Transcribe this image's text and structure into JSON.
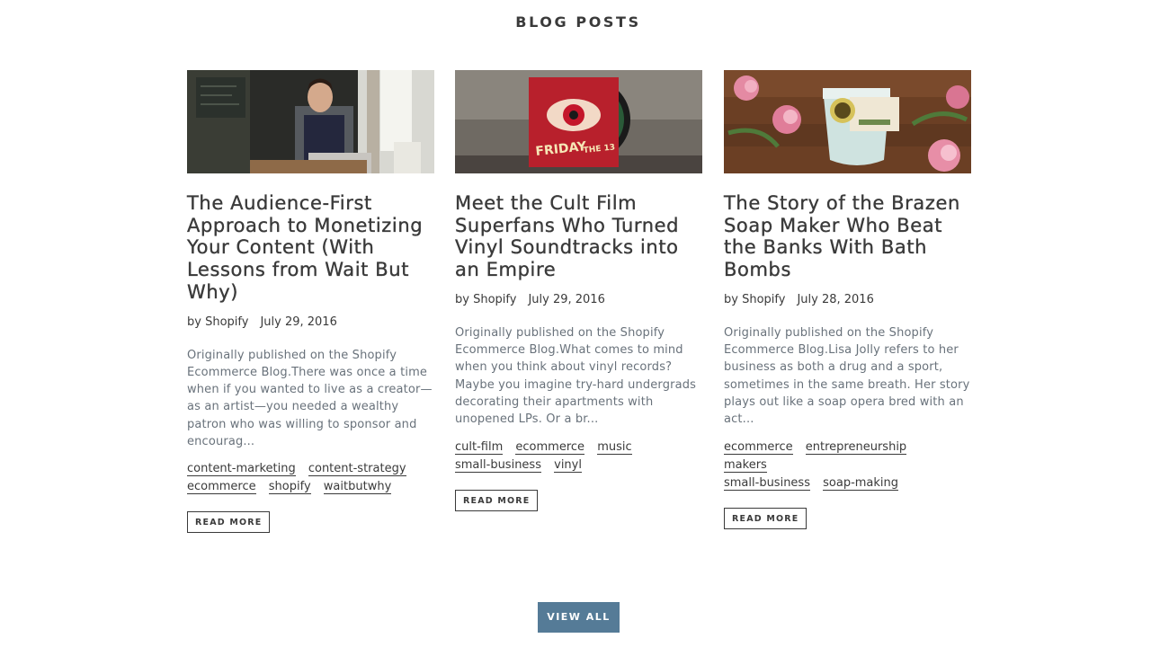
{
  "section": {
    "title": "BLOG POSTS",
    "view_all_label": "VIEW ALL"
  },
  "posts": [
    {
      "title": "The Audience-First Approach to Monetizing Your Content (With Lessons from Wait But Why)",
      "author": "by Shopify",
      "date": "July 29, 2016",
      "excerpt": "Originally published on the Shopify Ecommerce Blog.There was once a time when if you wanted to live as a creator—as an artist—you needed a wealthy patron who was willing to sponsor and encourag...",
      "tags": [
        "content-marketing",
        "content-strategy",
        "ecommerce",
        "shopify",
        "waitbutwhy"
      ],
      "read_more_label": "READ MORE"
    },
    {
      "title": "Meet the Cult Film Superfans Who Turned Vinyl Soundtracks into an Empire",
      "author": "by Shopify",
      "date": "July 29, 2016",
      "excerpt": "Originally published on the Shopify Ecommerce Blog.What comes to mind when you think about vinyl records?Maybe you imagine try-hard undergrads decorating their apartments with unopened LPs. Or a br...",
      "tags": [
        "cult-film",
        "ecommerce",
        "music",
        "small-business",
        "vinyl"
      ],
      "read_more_label": "READ MORE",
      "image_text": {
        "title_line1": "FRIDAY",
        "title_line2": "THE 13"
      }
    },
    {
      "title": "The Story of the Brazen Soap Maker Who Beat the Banks With Bath Bombs",
      "author": "by Shopify",
      "date": "July 28, 2016",
      "excerpt": "Originally published on the Shopify Ecommerce Blog.Lisa Jolly refers to her business as both a drug and a sport, sometimes in the same breath. Her story plays out like a soap opera bred with an act...",
      "tags": [
        "ecommerce",
        "entrepreneurship",
        "makers",
        "small-business",
        "soap-making"
      ],
      "read_more_label": "READ MORE"
    }
  ],
  "colors": {
    "text": "#3a3a3a",
    "excerpt": "#69727b",
    "button_bg": "#557b97",
    "button_text": "#ffffff"
  }
}
